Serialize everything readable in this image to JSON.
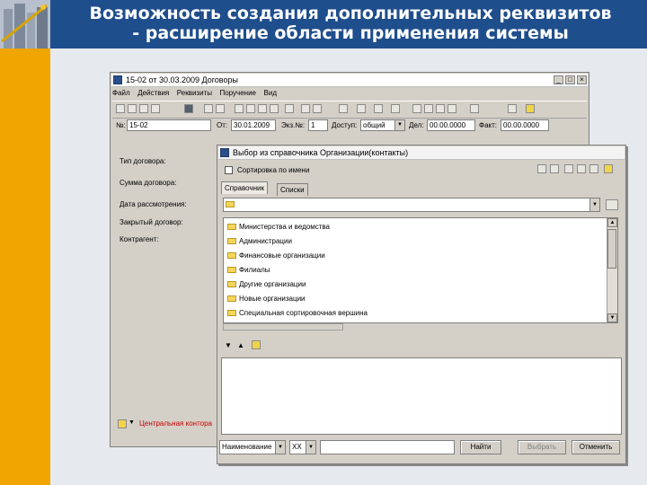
{
  "slide": {
    "title_line1": "Возможность создания дополнительных реквизитов",
    "title_line2": "- расширение области применения системы"
  },
  "main_window": {
    "title": "15-02 от 30.03.2009 Договоры",
    "menu": [
      "Файл",
      "Действия",
      "Реквизиты",
      "Поручение",
      "Вид"
    ],
    "fields": {
      "number_label": "№:",
      "number_value": "15-02",
      "from_label": "От:",
      "from_value": "30.01.2009",
      "copy_label": "Экз.№:",
      "copy_value": "1",
      "access_label": "Доступ:",
      "access_value": "общий",
      "till_label": "Дел:",
      "till_value": "00.00.0000",
      "fact_label": "Факт:",
      "fact_value": "00.00.0000"
    },
    "left_labels": [
      "Тип договора:",
      "Сумма договора:",
      "Дата рассмотрения:",
      "Закрытый договор:",
      "Контрагент:"
    ],
    "bottom_text": "Центральная контора",
    "colors": {
      "bottom_text": "#cc0000"
    }
  },
  "dialog": {
    "title": "Выбор из справочника Организации(контакты)",
    "sort_checkbox_label": "Сортировка по имени",
    "tabs": [
      "Справочник",
      "Списки"
    ],
    "list_items": [
      "Министерства и ведомства",
      "Администрации",
      "Финансовые организации",
      "Филиалы",
      "Другие организации",
      "Новые организации",
      "Специальная сортировочная вершина"
    ],
    "search": {
      "field_value": "Наименование",
      "op_value": "XX",
      "query_value": ""
    },
    "buttons": {
      "find": "Найти",
      "select": "Выбрать",
      "cancel": "Отменить"
    }
  },
  "colors": {
    "header_bg": "#1f4e8c",
    "left_bar": "#f0a500",
    "window_face": "#d4d0c8"
  }
}
